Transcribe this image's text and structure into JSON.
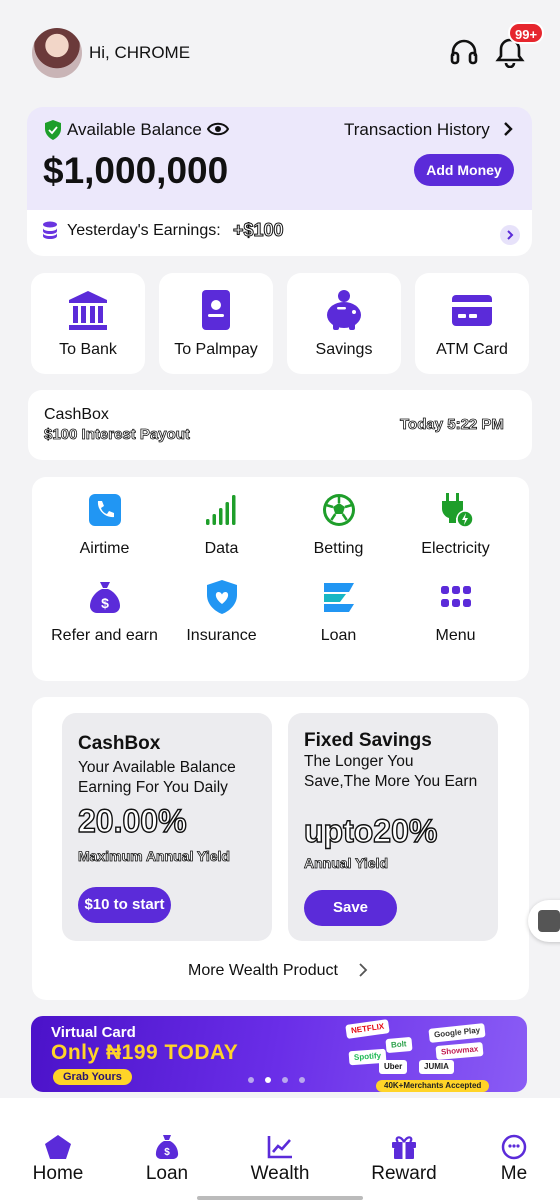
{
  "header": {
    "greeting": "Hi, CHROME",
    "notifications_badge": "99+"
  },
  "balance": {
    "label": "Available Balance",
    "amount": "$1,000,000",
    "history_link": "Transaction History",
    "add_money": "Add Money",
    "earnings_label": "Yesterday's Earnings:",
    "earnings_value": "+$100"
  },
  "quick_actions": [
    {
      "label": "To Bank",
      "icon": "bank-icon"
    },
    {
      "label": "To Palmpay",
      "icon": "person-card-icon"
    },
    {
      "label": "Savings",
      "icon": "piggy-bank-icon"
    },
    {
      "label": "ATM Card",
      "icon": "card-icon"
    }
  ],
  "cashbox_notice": {
    "title": "CashBox",
    "subtitle": "$100 Interest Payout",
    "time": "Today 5:22 PM"
  },
  "services": [
    {
      "label": "Airtime",
      "icon": "phone-icon"
    },
    {
      "label": "Data",
      "icon": "signal-bars-icon"
    },
    {
      "label": "Betting",
      "icon": "soccer-ball-icon"
    },
    {
      "label": "Electricity",
      "icon": "plug-icon"
    },
    {
      "label": "Refer and earn",
      "icon": "money-bag-icon"
    },
    {
      "label": "Insurance",
      "icon": "shield-heart-icon"
    },
    {
      "label": "Loan",
      "icon": "loan-icon"
    },
    {
      "label": "Menu",
      "icon": "grid-icon"
    }
  ],
  "wealth": {
    "cashbox": {
      "title": "CashBox",
      "desc": "Your Available Balance Earning For You Daily",
      "rate": "20.00%",
      "rate_label": "Maximum Annual Yield",
      "button": "$10 to start"
    },
    "fixed": {
      "title": "Fixed Savings",
      "desc": "The Longer You Save,The More You Earn",
      "rate": "upto20%",
      "rate_label": "Annual Yield",
      "button": "Save"
    },
    "more_link": "More Wealth Product"
  },
  "banner": {
    "line1": "Virtual Card",
    "line2": "Only ₦199 TODAY",
    "button": "Grab Yours",
    "brands": [
      "NETFLIX",
      "Bolt",
      "Google Play",
      "Showmax",
      "JUMIA",
      "Uber",
      "Spotify"
    ],
    "merchants": "40K+Merchants Accepted",
    "active_slide": 1,
    "slide_count": 4
  },
  "nav": [
    {
      "label": "Home",
      "icon": "home-icon",
      "active": true
    },
    {
      "label": "Loan",
      "icon": "loan-bag-icon"
    },
    {
      "label": "Wealth",
      "icon": "chart-icon"
    },
    {
      "label": "Reward",
      "icon": "gift-icon"
    },
    {
      "label": "Me",
      "icon": "smiley-icon"
    }
  ],
  "colors": {
    "primary": "#5b2bd9",
    "green": "#1e9e2a",
    "blue": "#2196f3",
    "badge": "#e6262e",
    "card_bg": "#ece8fb"
  }
}
